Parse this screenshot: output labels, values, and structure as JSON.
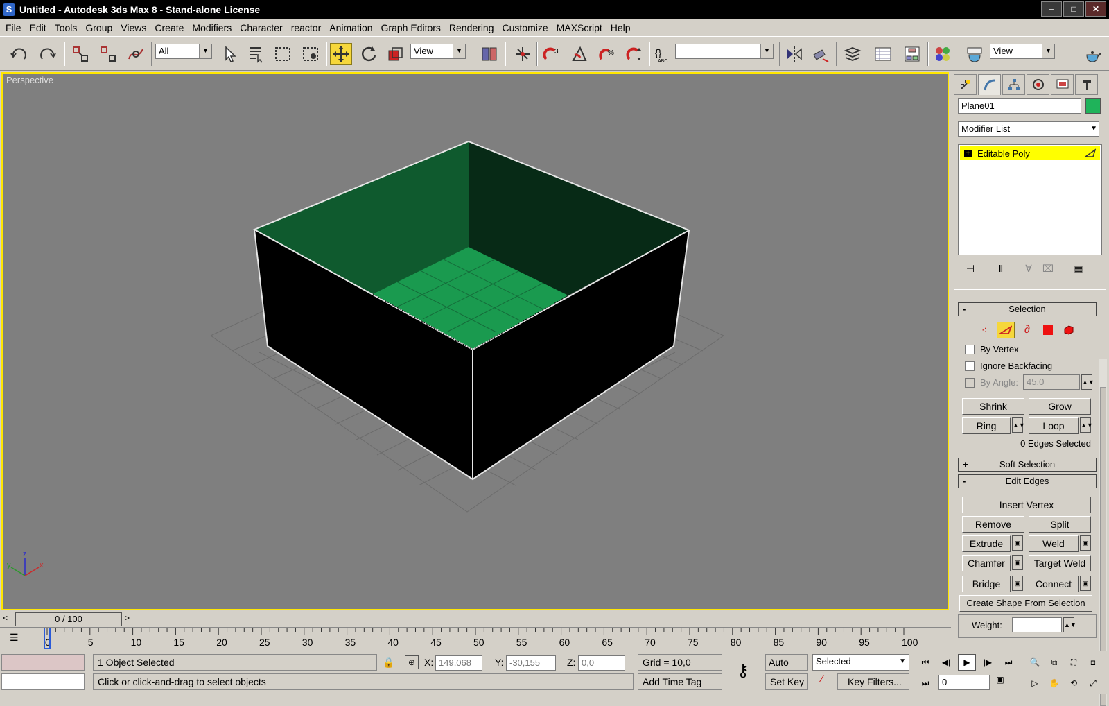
{
  "titlebar": {
    "title": "Untitled - Autodesk 3ds Max 8  - Stand-alone License",
    "minimize": "–",
    "maximize": "□",
    "close": "✕"
  },
  "menu": [
    "File",
    "Edit",
    "Tools",
    "Group",
    "Views",
    "Create",
    "Modifiers",
    "Character",
    "reactor",
    "Animation",
    "Graph Editors",
    "Rendering",
    "Customize",
    "MAXScript",
    "Help"
  ],
  "toolbar": {
    "selection_filter": "All",
    "ref_coord": "View",
    "named_selection": "",
    "render_type": "View"
  },
  "viewport": {
    "label": "Perspective",
    "axis_x": "x",
    "axis_y": "y",
    "axis_z": "z",
    "colors": {
      "border_active": "#ffe600",
      "background": "#7f7f7f",
      "object": "#1e9a52"
    }
  },
  "command_panel": {
    "object_name": "Plane01",
    "object_color": "#1fb35a",
    "modifier_list": "Modifier List",
    "stack_item": "Editable Poly",
    "selection_rollout": "Selection",
    "by_vertex": "By Vertex",
    "ignore_backfacing": "Ignore Backfacing",
    "by_angle": "By Angle:",
    "by_angle_value": "45,0",
    "shrink": "Shrink",
    "grow": "Grow",
    "ring": "Ring",
    "loop": "Loop",
    "edges_selected": "0 Edges Selected",
    "soft_selection": "Soft Selection",
    "edit_edges": "Edit Edges",
    "insert_vertex": "Insert Vertex",
    "remove": "Remove",
    "split": "Split",
    "extrude": "Extrude",
    "weld": "Weld",
    "chamfer": "Chamfer",
    "target_weld": "Target Weld",
    "bridge": "Bridge",
    "connect": "Connect",
    "create_shape": "Create Shape From Selection",
    "weight": "Weight:",
    "rollout_minus": "-",
    "rollout_plus": "+"
  },
  "timeline": {
    "frame_display": "0 / 100",
    "ticks": [
      "0",
      "5",
      "10",
      "15",
      "20",
      "25",
      "30",
      "35",
      "40",
      "45",
      "50",
      "55",
      "60",
      "65",
      "70",
      "75",
      "80",
      "85",
      "90",
      "95",
      "100"
    ]
  },
  "status": {
    "objects_selected": "1 Object Selected",
    "prompt": "Click or click-and-drag to select objects",
    "x_label": "X:",
    "x_value": "149,068",
    "y_label": "Y:",
    "y_value": "-30,155",
    "z_label": "Z:",
    "z_value": "0,0",
    "grid": "Grid = 10,0",
    "add_time_tag": "Add Time Tag",
    "auto_key": "Auto Key",
    "set_key": "Set Key",
    "key_mode": "Selected",
    "key_filters": "Key Filters...",
    "current_frame": "0"
  }
}
